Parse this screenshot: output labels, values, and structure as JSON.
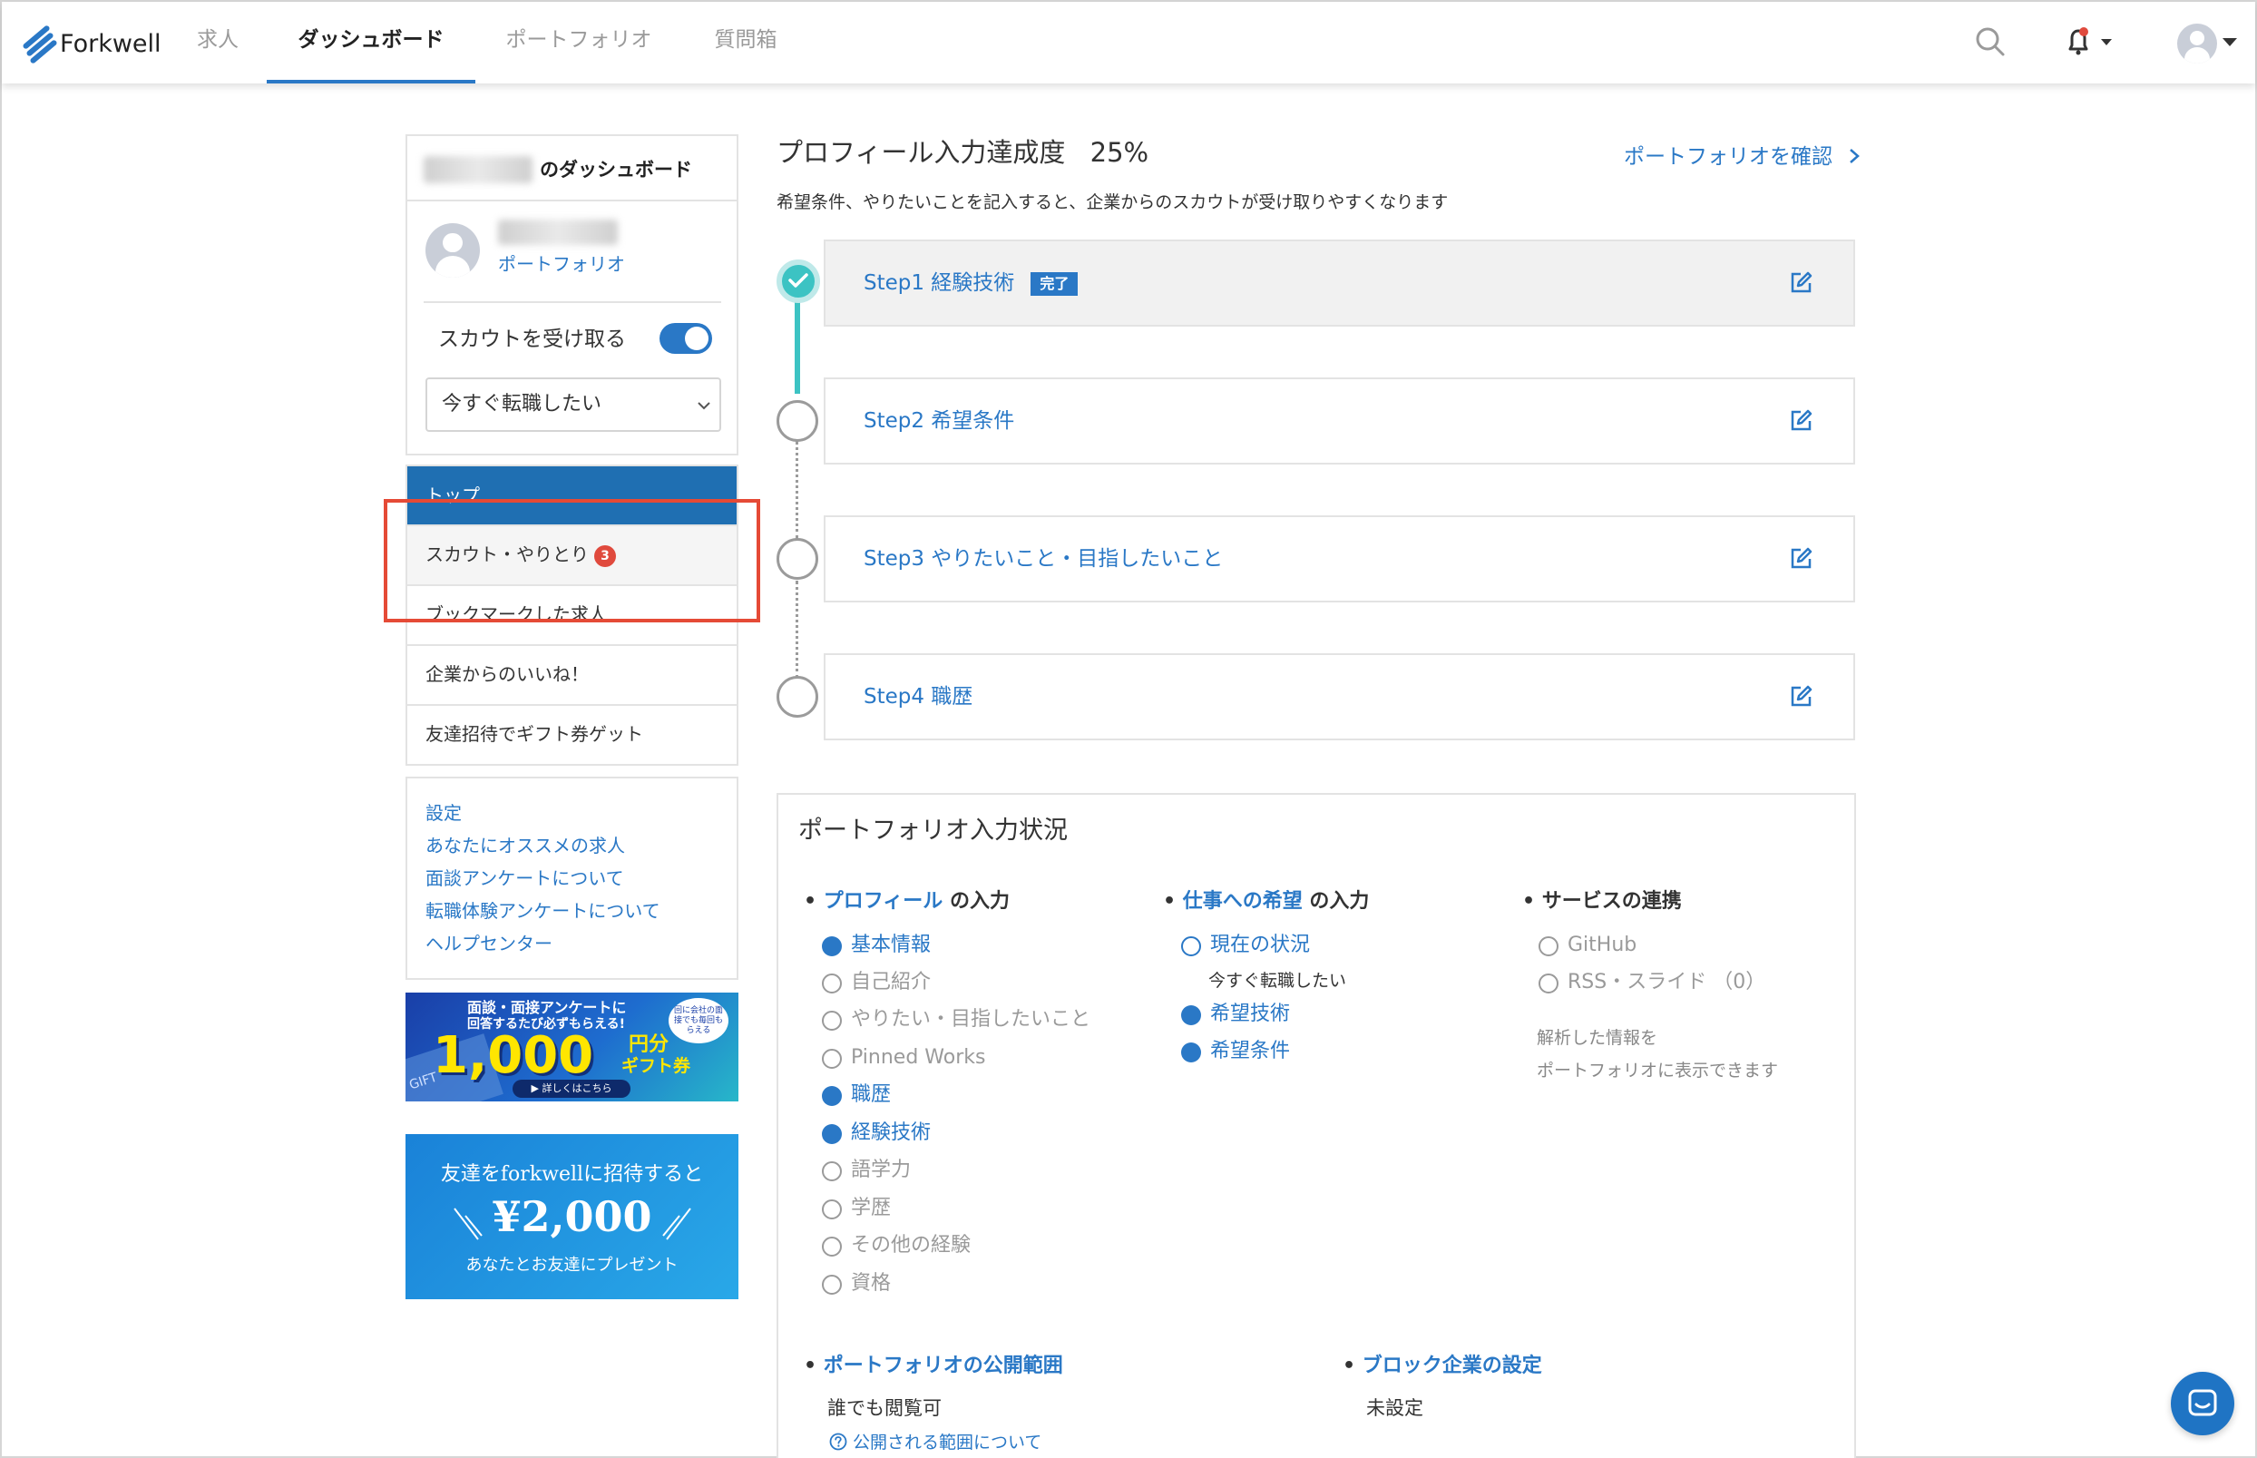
{
  "header": {
    "logo": "Forkwell",
    "tabs": [
      "求人",
      "ダッシュボード",
      "ポートフォリオ",
      "質問箱"
    ],
    "active_tab": "ダッシュボード"
  },
  "sidebar": {
    "title_suffix": "のダッシュボード",
    "portfolio_link": "ポートフォリオ",
    "scout_label": "スカウトを受け取る",
    "scout_enabled": true,
    "status_select": "今すぐ転職したい",
    "menu": [
      {
        "label": "トップ",
        "active": true
      },
      {
        "label": "スカウト・やりとり",
        "badge": "3"
      },
      {
        "label": "ブックマークした求人"
      },
      {
        "label": "企業からのいいね！"
      },
      {
        "label": "友達招待でギフト券ゲット"
      }
    ],
    "links": [
      "設定",
      "あなたにオススメの求人",
      "面談アンケートについて",
      "転職体験アンケートについて",
      "ヘルプセンター"
    ],
    "banner1": {
      "line1": "面談・面接アンケートに",
      "line2": "回答するたび必ずもらえる!",
      "side": "回に会社の面接でも毎回もらえる",
      "amount": "1,000",
      "unit": "円分",
      "unit2": "ギフト券",
      "cta": "▶ 詳しくはこちら",
      "gift": "GIFT"
    },
    "banner2": {
      "line1": "友達をforkwellに招待すると",
      "amount": "¥2,000",
      "line2": "あなたとお友達にプレゼント"
    }
  },
  "main": {
    "progress_title": "プロフィール入力達成度",
    "progress_value": "25%",
    "confirm_link": "ポートフォリオを確認",
    "description": "希望条件、やりたいことを記入すると、企業からのスカウトが受け取りやすくなります",
    "steps": [
      {
        "label": "Step1 経験技術",
        "done": true,
        "tag": "完了"
      },
      {
        "label": "Step2 希望条件",
        "done": false
      },
      {
        "label": "Step3 やりたいこと・目指したいこと",
        "done": false
      },
      {
        "label": "Step4 職歴",
        "done": false
      }
    ],
    "portfolio": {
      "title": "ポートフォリオ入力状況",
      "profile": {
        "title_blue": "プロフィール",
        "title_rest": "の入力",
        "items": [
          {
            "label": "基本情報",
            "state": "on"
          },
          {
            "label": "自己紹介",
            "state": "off"
          },
          {
            "label": "やりたい・目指したいこと",
            "state": "off"
          },
          {
            "label": "Pinned Works",
            "state": "off"
          },
          {
            "label": "職歴",
            "state": "on"
          },
          {
            "label": "経験技術",
            "state": "on"
          },
          {
            "label": "語学力",
            "state": "off"
          },
          {
            "label": "学歴",
            "state": "off"
          },
          {
            "label": "その他の経験",
            "state": "off"
          },
          {
            "label": "資格",
            "state": "off"
          }
        ]
      },
      "work": {
        "title_blue": "仕事への希望",
        "title_rest": "の入力",
        "current_label": "現在の状況",
        "current_value": "今すぐ転職したい",
        "items": [
          {
            "label": "希望技術",
            "state": "on"
          },
          {
            "label": "希望条件",
            "state": "on"
          }
        ]
      },
      "service": {
        "title": "サービスの連携",
        "items": [
          {
            "label": "GitHub",
            "state": "off"
          },
          {
            "label": "RSS・スライド （0）",
            "state": "off"
          }
        ],
        "note1": "解析した情報を",
        "note2": "ポートフォリオに表示できます"
      },
      "visibility": {
        "title": "ポートフォリオの公開範囲",
        "value": "誰でも閲覧可",
        "help": "公開される範囲について"
      },
      "block": {
        "title": "ブロック企業の設定",
        "value": "未設定"
      }
    }
  }
}
